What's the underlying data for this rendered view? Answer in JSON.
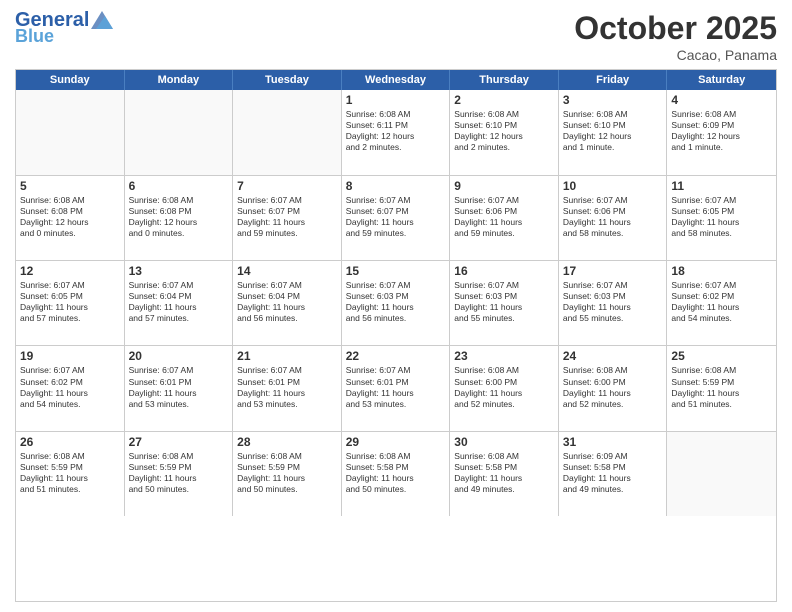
{
  "header": {
    "logo_general": "General",
    "logo_blue": "Blue",
    "month": "October 2025",
    "location": "Cacao, Panama"
  },
  "weekdays": [
    "Sunday",
    "Monday",
    "Tuesday",
    "Wednesday",
    "Thursday",
    "Friday",
    "Saturday"
  ],
  "rows": [
    [
      {
        "day": "",
        "empty": true
      },
      {
        "day": "",
        "empty": true
      },
      {
        "day": "",
        "empty": true
      },
      {
        "day": "1",
        "info": "Sunrise: 6:08 AM\nSunset: 6:11 PM\nDaylight: 12 hours\nand 2 minutes."
      },
      {
        "day": "2",
        "info": "Sunrise: 6:08 AM\nSunset: 6:10 PM\nDaylight: 12 hours\nand 2 minutes."
      },
      {
        "day": "3",
        "info": "Sunrise: 6:08 AM\nSunset: 6:10 PM\nDaylight: 12 hours\nand 1 minute."
      },
      {
        "day": "4",
        "info": "Sunrise: 6:08 AM\nSunset: 6:09 PM\nDaylight: 12 hours\nand 1 minute."
      }
    ],
    [
      {
        "day": "5",
        "info": "Sunrise: 6:08 AM\nSunset: 6:08 PM\nDaylight: 12 hours\nand 0 minutes."
      },
      {
        "day": "6",
        "info": "Sunrise: 6:08 AM\nSunset: 6:08 PM\nDaylight: 12 hours\nand 0 minutes."
      },
      {
        "day": "7",
        "info": "Sunrise: 6:07 AM\nSunset: 6:07 PM\nDaylight: 11 hours\nand 59 minutes."
      },
      {
        "day": "8",
        "info": "Sunrise: 6:07 AM\nSunset: 6:07 PM\nDaylight: 11 hours\nand 59 minutes."
      },
      {
        "day": "9",
        "info": "Sunrise: 6:07 AM\nSunset: 6:06 PM\nDaylight: 11 hours\nand 59 minutes."
      },
      {
        "day": "10",
        "info": "Sunrise: 6:07 AM\nSunset: 6:06 PM\nDaylight: 11 hours\nand 58 minutes."
      },
      {
        "day": "11",
        "info": "Sunrise: 6:07 AM\nSunset: 6:05 PM\nDaylight: 11 hours\nand 58 minutes."
      }
    ],
    [
      {
        "day": "12",
        "info": "Sunrise: 6:07 AM\nSunset: 6:05 PM\nDaylight: 11 hours\nand 57 minutes."
      },
      {
        "day": "13",
        "info": "Sunrise: 6:07 AM\nSunset: 6:04 PM\nDaylight: 11 hours\nand 57 minutes."
      },
      {
        "day": "14",
        "info": "Sunrise: 6:07 AM\nSunset: 6:04 PM\nDaylight: 11 hours\nand 56 minutes."
      },
      {
        "day": "15",
        "info": "Sunrise: 6:07 AM\nSunset: 6:03 PM\nDaylight: 11 hours\nand 56 minutes."
      },
      {
        "day": "16",
        "info": "Sunrise: 6:07 AM\nSunset: 6:03 PM\nDaylight: 11 hours\nand 55 minutes."
      },
      {
        "day": "17",
        "info": "Sunrise: 6:07 AM\nSunset: 6:03 PM\nDaylight: 11 hours\nand 55 minutes."
      },
      {
        "day": "18",
        "info": "Sunrise: 6:07 AM\nSunset: 6:02 PM\nDaylight: 11 hours\nand 54 minutes."
      }
    ],
    [
      {
        "day": "19",
        "info": "Sunrise: 6:07 AM\nSunset: 6:02 PM\nDaylight: 11 hours\nand 54 minutes."
      },
      {
        "day": "20",
        "info": "Sunrise: 6:07 AM\nSunset: 6:01 PM\nDaylight: 11 hours\nand 53 minutes."
      },
      {
        "day": "21",
        "info": "Sunrise: 6:07 AM\nSunset: 6:01 PM\nDaylight: 11 hours\nand 53 minutes."
      },
      {
        "day": "22",
        "info": "Sunrise: 6:07 AM\nSunset: 6:01 PM\nDaylight: 11 hours\nand 53 minutes."
      },
      {
        "day": "23",
        "info": "Sunrise: 6:08 AM\nSunset: 6:00 PM\nDaylight: 11 hours\nand 52 minutes."
      },
      {
        "day": "24",
        "info": "Sunrise: 6:08 AM\nSunset: 6:00 PM\nDaylight: 11 hours\nand 52 minutes."
      },
      {
        "day": "25",
        "info": "Sunrise: 6:08 AM\nSunset: 5:59 PM\nDaylight: 11 hours\nand 51 minutes."
      }
    ],
    [
      {
        "day": "26",
        "info": "Sunrise: 6:08 AM\nSunset: 5:59 PM\nDaylight: 11 hours\nand 51 minutes."
      },
      {
        "day": "27",
        "info": "Sunrise: 6:08 AM\nSunset: 5:59 PM\nDaylight: 11 hours\nand 50 minutes."
      },
      {
        "day": "28",
        "info": "Sunrise: 6:08 AM\nSunset: 5:59 PM\nDaylight: 11 hours\nand 50 minutes."
      },
      {
        "day": "29",
        "info": "Sunrise: 6:08 AM\nSunset: 5:58 PM\nDaylight: 11 hours\nand 50 minutes."
      },
      {
        "day": "30",
        "info": "Sunrise: 6:08 AM\nSunset: 5:58 PM\nDaylight: 11 hours\nand 49 minutes."
      },
      {
        "day": "31",
        "info": "Sunrise: 6:09 AM\nSunset: 5:58 PM\nDaylight: 11 hours\nand 49 minutes."
      },
      {
        "day": "",
        "empty": true
      }
    ]
  ]
}
